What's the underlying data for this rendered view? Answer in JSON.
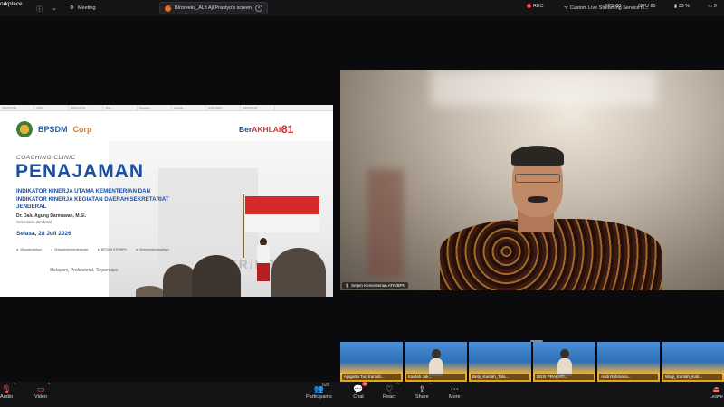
{
  "topbar": {
    "app_label": "orkplace",
    "tabs": [
      {
        "label": "Meeting"
      },
      {
        "label": "Biroreeks_ALit Aji Prastyo's screen"
      }
    ],
    "rec_label": "REC",
    "live_label": "Custom Live Streaming Service is...",
    "stats": [
      "FPS 60",
      "GPU 85",
      "33 %",
      "0"
    ]
  },
  "slide": {
    "browser_tabs": [
      "INDIKATOR ...",
      "TAKE ...",
      "INDIKATOR ...",
      "Tiket ...",
      "Pegawai ...",
      "Pejabat ...",
      "DOKUMEN ...",
      "INDIKATOR ..."
    ],
    "logo_bpsdm": "BPSDM",
    "logo_corpu": "Corp",
    "logo_berakhlak_1": "Ber",
    "logo_berakhlak_2": "AKHLAK",
    "logo_81": "81",
    "coaching_label": "COACHING CLINIC",
    "title": "PENAJAMAN",
    "subtitle_lines": "INDIKATOR KINERJA UTAMA KEMENTERIAN DAN INDIKATOR KINERJA KEGIATAN DAERAH SEKRETARIAT JENDERAL",
    "speaker_name": "Dr. Dalu Agung Darmawan, M.Si.",
    "speaker_role": "Sekretaris Jenderal",
    "date": "Selasa, 28 Juli 2026",
    "socials": [
      "@bpsdmatrbpn",
      "@bpsdmkementerianatr",
      "BPSDM ATR/BPN",
      "@kementerianatrbpn"
    ],
    "tagline": "Melayani, Profesional, Terpercaya",
    "watermark": "ATR/BPN"
  },
  "speaker": {
    "name_tag": "Setjen Kementerian ATR/BPN"
  },
  "thumbnails": [
    {
      "name": "Ajagatra Tur, Kantah..."
    },
    {
      "name": "Kantah Jak..."
    },
    {
      "name": "Bety_Kantah_Tola..."
    },
    {
      "name": "DESI PRAKATI..."
    },
    {
      "name": "Andi Rohmana..."
    },
    {
      "name": "Wagi_Kantah_Kab..."
    }
  ],
  "toolbar": {
    "audio": "Audio",
    "video": "Video",
    "participants": "Participants",
    "participants_count": "620",
    "chat": "Chat",
    "chat_badge": "9",
    "react": "React",
    "share": "Share",
    "more": "More",
    "leave": "Leave"
  },
  "colors": {
    "accent_red": "#d93030",
    "slide_blue": "#1a4fa0",
    "toolbar_bg": "#141416"
  }
}
